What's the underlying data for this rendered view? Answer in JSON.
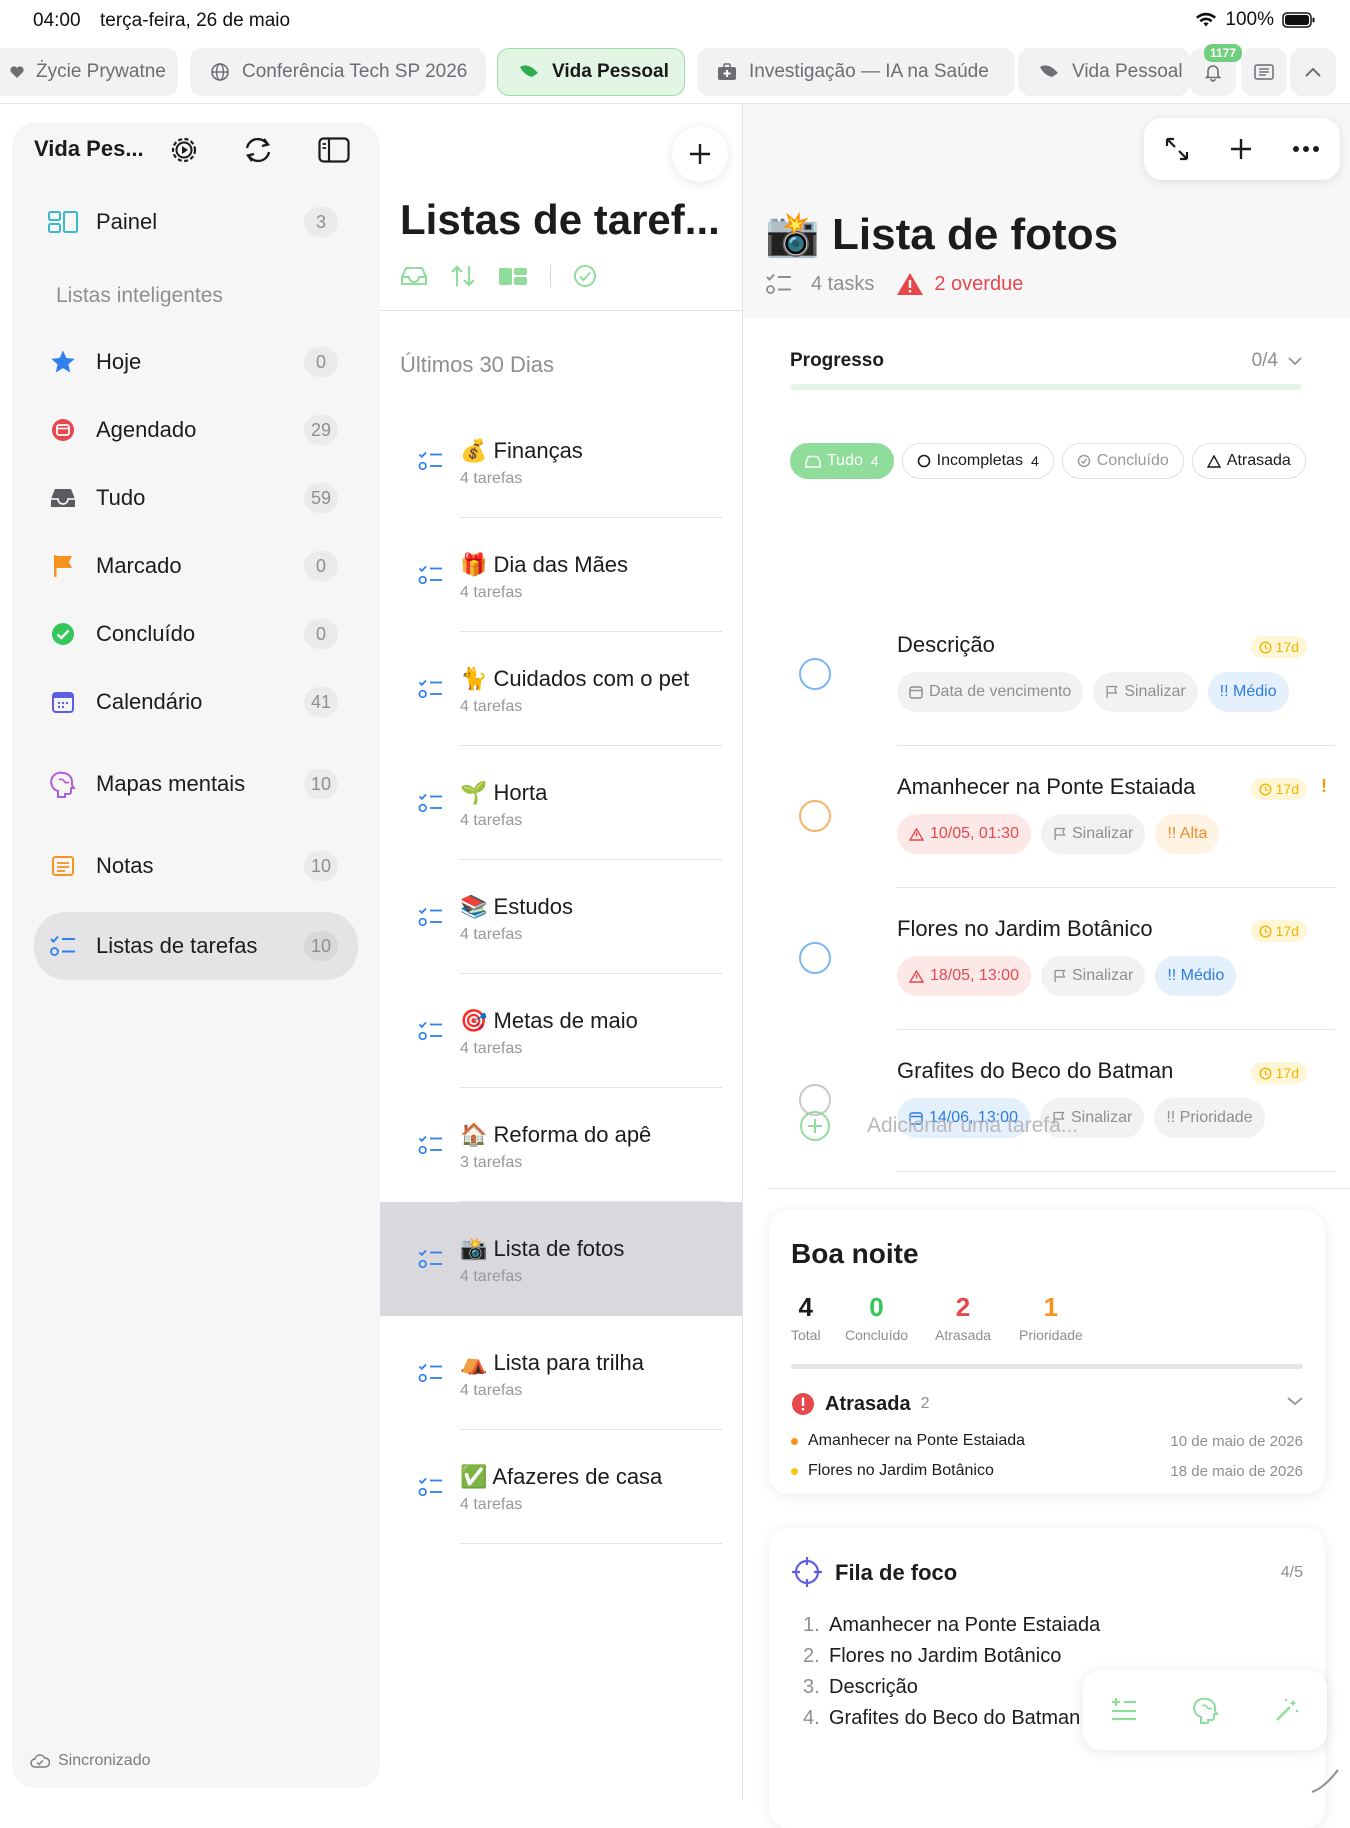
{
  "status": {
    "time": "04:00",
    "date": "terça-feira, 26 de maio",
    "battery": "100%"
  },
  "tabs": [
    {
      "label": "Życie Prywatne"
    },
    {
      "label": "Conferência Tech SP 2026"
    },
    {
      "label": "Vida Pessoal"
    },
    {
      "label": "Investigação — IA na Saúde"
    },
    {
      "label": "Vida Pessoal"
    }
  ],
  "notifications_badge": "1177",
  "sidebar": {
    "title": "Vida Pes...",
    "section": "Listas inteligentes",
    "sync": "Sincronizado",
    "items": [
      {
        "label": "Painel",
        "count": "3",
        "icon": "dashboard-icon",
        "color": "#3bb9c9"
      },
      {
        "label": "Hoje",
        "count": "0",
        "icon": "star-icon",
        "color": "#2f80ed"
      },
      {
        "label": "Agendado",
        "count": "29",
        "icon": "calendar-clock-icon",
        "color": "#e5484d"
      },
      {
        "label": "Tudo",
        "count": "59",
        "icon": "inbox-icon",
        "color": "#5a5a60"
      },
      {
        "label": "Marcado",
        "count": "0",
        "icon": "flag-icon",
        "color": "#f7931e"
      },
      {
        "label": "Concluído",
        "count": "0",
        "icon": "check-circle-icon",
        "color": "#34c759"
      },
      {
        "label": "Calendário",
        "count": "41",
        "icon": "calendar-icon",
        "color": "#5b5fe0"
      },
      {
        "label": "Mapas mentais",
        "count": "10",
        "icon": "brain-icon",
        "color": "#b15fd6"
      },
      {
        "label": "Notas",
        "count": "10",
        "icon": "notes-icon",
        "color": "#f7931e"
      },
      {
        "label": "Listas de tarefas",
        "count": "10",
        "icon": "checklist-icon",
        "color": "#2f80ed"
      }
    ]
  },
  "middle": {
    "title": "Listas de taref...",
    "section": "Últimos 30 Dias",
    "lists": [
      {
        "emoji": "💰",
        "name": "Finanças",
        "sub": "4 tarefas"
      },
      {
        "emoji": "🎁",
        "name": "Dia das Mães",
        "sub": "4 tarefas"
      },
      {
        "emoji": "🐈",
        "name": "Cuidados com o pet",
        "sub": "4 tarefas"
      },
      {
        "emoji": "🌱",
        "name": "Horta",
        "sub": "4 tarefas"
      },
      {
        "emoji": "📚",
        "name": "Estudos",
        "sub": "4 tarefas"
      },
      {
        "emoji": "🎯",
        "name": "Metas de maio",
        "sub": "4 tarefas"
      },
      {
        "emoji": "🏠",
        "name": "Reforma do apê",
        "sub": "3 tarefas"
      },
      {
        "emoji": "📸",
        "name": "Lista de fotos",
        "sub": "4 tarefas"
      },
      {
        "emoji": "⛺",
        "name": "Lista para trilha",
        "sub": "4 tarefas"
      },
      {
        "emoji": "✅",
        "name": "Afazeres de casa",
        "sub": "4 tarefas"
      }
    ]
  },
  "detail": {
    "emoji": "📸",
    "title": "Lista de fotos",
    "tasks_count": "4 tasks",
    "overdue": "2 overdue",
    "progress_label": "Progresso",
    "progress_value": "0/4",
    "progress_fraction": 0,
    "filters": [
      {
        "label": "Tudo",
        "count": "4"
      },
      {
        "label": "Incompletas",
        "count": "4"
      },
      {
        "label": "Concluído",
        "count": ""
      },
      {
        "label": "Atrasada",
        "count": ""
      }
    ],
    "tasks": [
      {
        "name": "Descrição",
        "age": "17d",
        "date": "Data de vencimento",
        "flag": "Sinalizar",
        "priority": "!! Médio"
      },
      {
        "name": "Amanhecer na Ponte Estaiada",
        "age": "17d",
        "date": "10/05, 01:30",
        "flag": "Sinalizar",
        "priority": "!! Alta",
        "excl": "!"
      },
      {
        "name": "Flores no Jardim Botânico",
        "age": "17d",
        "date": "18/05, 13:00",
        "flag": "Sinalizar",
        "priority": "!! Médio"
      },
      {
        "name": "Grafites do Beco do Batman",
        "age": "17d",
        "date": "14/06, 13:00",
        "flag": "Sinalizar",
        "priority": "!! Prioridade"
      }
    ],
    "add_task": "Adicionar uma tarefa..."
  },
  "summary": {
    "title": "Boa noite",
    "stats": [
      {
        "value": "4",
        "label": "Total",
        "color": "#1c1c1e"
      },
      {
        "value": "0",
        "label": "Concluído",
        "color": "#34c759"
      },
      {
        "value": "2",
        "label": "Atrasada",
        "color": "#e5484d"
      },
      {
        "value": "1",
        "label": "Prioridade",
        "color": "#f7931e"
      }
    ],
    "overdue_title": "Atrasada",
    "overdue_count": "2",
    "overdue_items": [
      {
        "name": "Amanhecer na Ponte Estaiada",
        "date": "10 de maio de 2026",
        "color": "#f7931e"
      },
      {
        "name": "Flores no Jardim Botânico",
        "date": "18 de maio de 2026",
        "color": "#f5c518"
      }
    ]
  },
  "focus": {
    "title": "Fila de foco",
    "count": "4/5",
    "items": [
      {
        "num": "1.",
        "name": "Amanhecer na Ponte Estaiada"
      },
      {
        "num": "2.",
        "name": "Flores no Jardim Botânico"
      },
      {
        "num": "3.",
        "name": "Descrição"
      },
      {
        "num": "4.",
        "name": "Grafites do Beco do Batman"
      }
    ]
  }
}
